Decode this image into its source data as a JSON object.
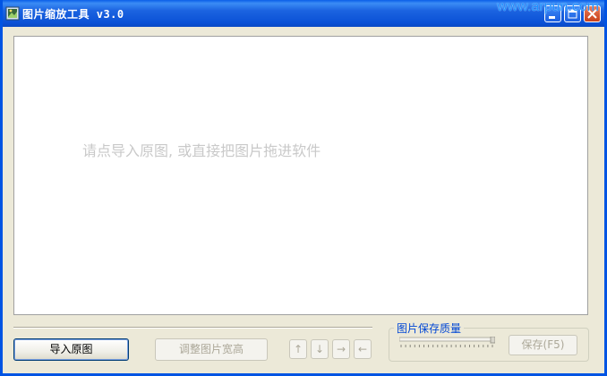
{
  "window": {
    "title": "图片缩放工具 v3.0",
    "watermark": "www.arpun.com"
  },
  "canvas": {
    "hint": "请点导入原图, 或直接把图片拖进软件"
  },
  "buttons": {
    "import_label": "导入原图",
    "resize_label": "调整图片宽高",
    "up_label": "↑",
    "down_label": "↓",
    "right_label": "→",
    "left_label": "←",
    "save_label": "保存(F5)"
  },
  "quality": {
    "group_label": "图片保存质量",
    "level": 1.0
  },
  "colors": {
    "titlebar": "#0b51d6",
    "hint_text": "#c9c9c9",
    "group_label": "#0046d5",
    "watermark": "#1e90ff"
  }
}
